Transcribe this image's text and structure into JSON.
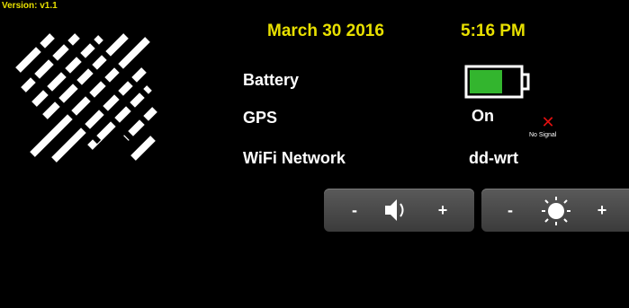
{
  "version": "Version: v1.1",
  "header": {
    "date": "March 30 2016",
    "time": "5:16 PM"
  },
  "status": {
    "battery_label": "Battery",
    "battery_level": 0.8,
    "gps_label": "GPS",
    "gps_value": "On",
    "gps_signal_text": "No Signal",
    "wifi_label": "WiFi Network",
    "wifi_value": "dd-wrt"
  },
  "volume": {
    "decrease_label": "-",
    "increase_label": "+",
    "icon": "speaker-icon"
  },
  "brightness": {
    "decrease_label": "-",
    "increase_label": "+",
    "icon": "sun-icon"
  },
  "colors": {
    "background": "#000000",
    "header_text": "#e8e000",
    "battery_fill": "#33b52e",
    "no_signal_x": "#e01010",
    "panel": "#4a4a4a"
  }
}
